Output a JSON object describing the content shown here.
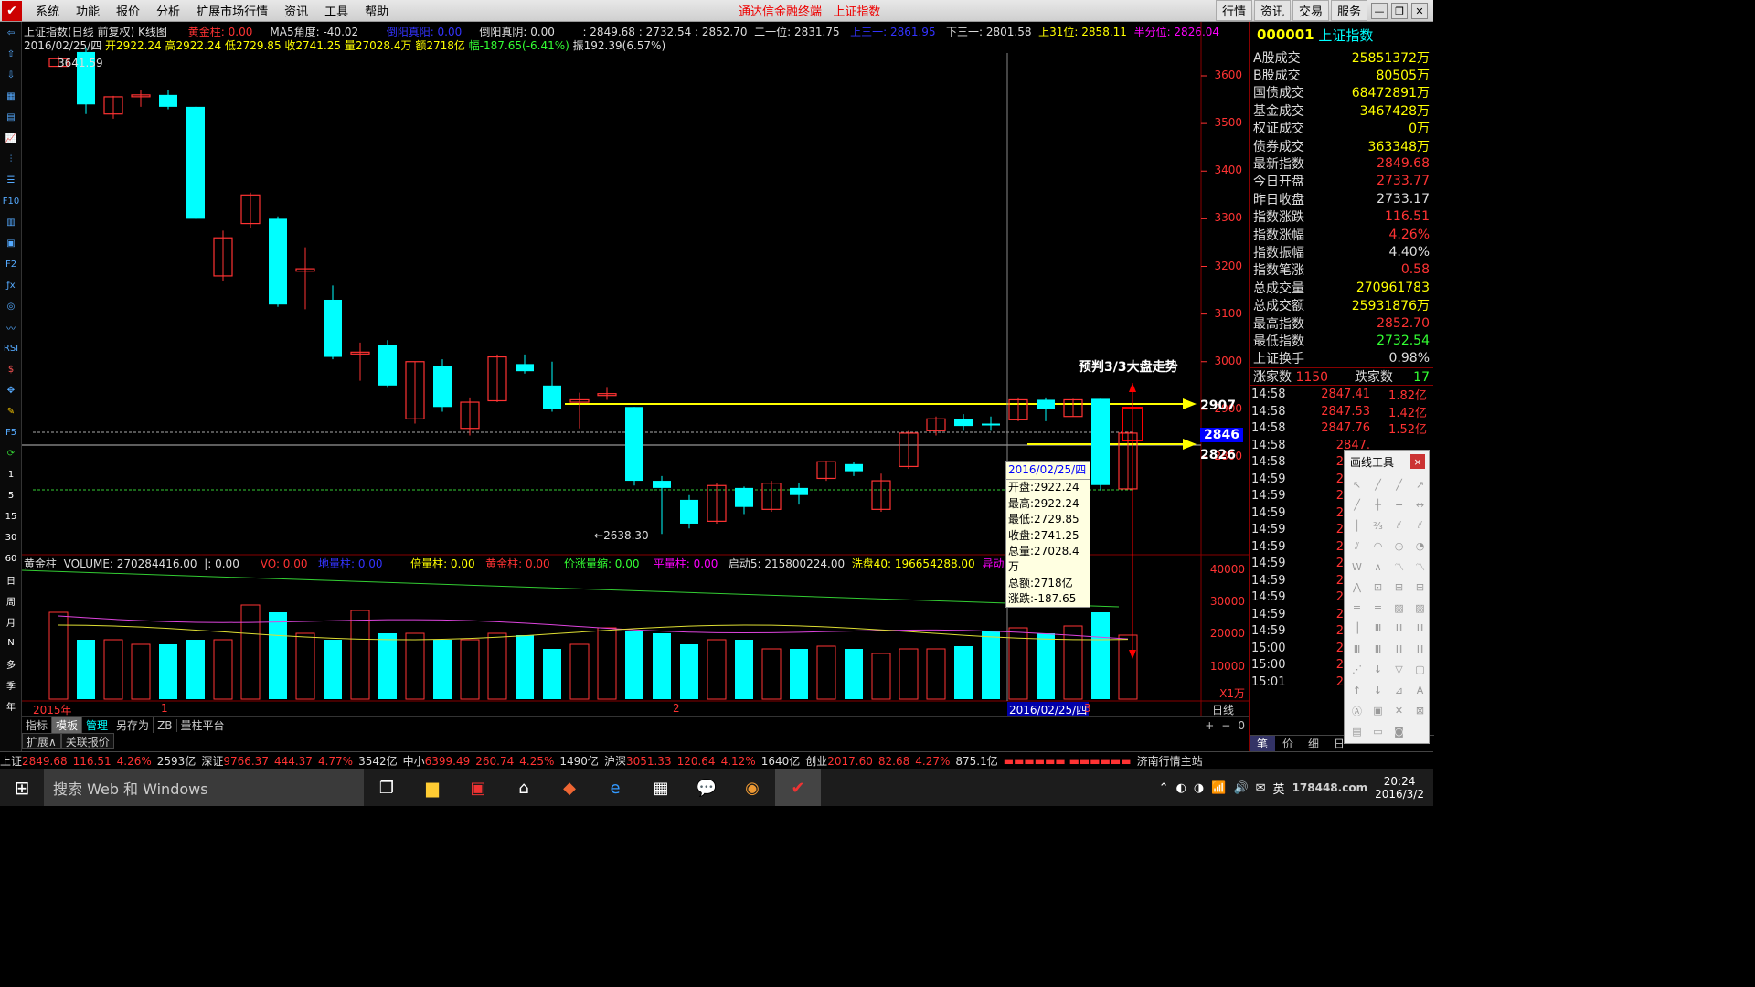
{
  "menu": {
    "items": [
      "系统",
      "功能",
      "报价",
      "分析",
      "扩展市场行情",
      "资讯",
      "工具",
      "帮助"
    ],
    "center_title": "通达信金融终端",
    "center_sub": "上证指数",
    "right_tabs": [
      "行情",
      "资讯",
      "交易",
      "服务"
    ]
  },
  "info": {
    "title": "上证指数(日线 前复权) K线图",
    "gold_col": "黄金柱: 0.00",
    "ma5_angle": "MA5角度: -40.02",
    "true_yin": "倒阳真阴: 0.00",
    "pct_cut": "倒阳真阳: 0.00",
    "prices": ": 2849.68 : 2732.54 : 2852.70",
    "two_one": "二一位: 2831.75",
    "up_three": "上三一: 2861.95",
    "down_three": "下三一: 2801.58",
    "up_31": "上31位: 2858.11",
    "half": "半分位: 2826.04",
    "date": "2016/02/25/四",
    "open": "开2922.24",
    "high": "高2922.24",
    "low": "低2729.85",
    "close": "收2741.25",
    "vol": "量27028.4万",
    "amt": "额2718亿",
    "chg": "幅-187.65(-6.41%)",
    "amp": "振192.39(6.57%)"
  },
  "chart_labels": {
    "high_mark": "3641.59",
    "low_mark": "2638.30",
    "predict": "预判3/3大盘走势",
    "level_2907": "2907",
    "level_2846": "2846",
    "level_2826": "2826"
  },
  "yaxis": [
    "3600",
    "3500",
    "3400",
    "3300",
    "3200",
    "3100",
    "3000",
    "2900",
    "2800"
  ],
  "vol_axis": [
    "40000",
    "30000",
    "20000",
    "10000",
    "X1万"
  ],
  "vol_info": {
    "name": "黄金柱",
    "volume": "VOLUME: 270284416.00",
    "i": "|: 0.00",
    "vo": "VO: 0.00",
    "dlz": "地量柱: 0.00",
    "blz": "倍量柱: 0.00",
    "hjz": "黄金柱: 0.00",
    "jzls": "价涨量缩: 0.00",
    "plz": "平量柱: 0.00",
    "qd5": "启动5: 215800224.00",
    "xp40": "洗盘40: 196654288.00",
    "yd135": "异动135: 28316236"
  },
  "xaxis": {
    "year": "2015年",
    "m1": "1",
    "m2": "2",
    "sel": "2016/02/25/四",
    "m3": "3",
    "period": "日线"
  },
  "tooltip": {
    "date": "2016/02/25/四",
    "open": "开盘:2922.24",
    "high": "最高:2922.24",
    "low": "最低:2729.85",
    "close": "收盘:2741.25",
    "vol": "总量:27028.4万",
    "amt": "总额:2718亿",
    "chg": "涨跌:-187.65",
    "pct": "涨幅:-6.41%"
  },
  "right": {
    "code": "000001",
    "name": "上证指数",
    "rows": [
      {
        "label": "A股成交",
        "value": "25851372万",
        "color": "#ff0"
      },
      {
        "label": "B股成交",
        "value": "80505万",
        "color": "#ff0"
      },
      {
        "label": "国债成交",
        "value": "68472891万",
        "color": "#ff0"
      },
      {
        "label": "基金成交",
        "value": "3467428万",
        "color": "#ff0"
      },
      {
        "label": "权证成交",
        "value": "0万",
        "color": "#ff0"
      },
      {
        "label": "债券成交",
        "value": "363348万",
        "color": "#ff0"
      },
      {
        "label": "最新指数",
        "value": "2849.68",
        "color": "#f33"
      },
      {
        "label": "今日开盘",
        "value": "2733.77",
        "color": "#f33"
      },
      {
        "label": "昨日收盘",
        "value": "2733.17",
        "color": "#ddd"
      },
      {
        "label": "指数涨跌",
        "value": "116.51",
        "color": "#f33"
      },
      {
        "label": "指数涨幅",
        "value": "4.26%",
        "color": "#f33"
      },
      {
        "label": "指数振幅",
        "value": "4.40%",
        "color": "#ddd"
      },
      {
        "label": "指数笔涨",
        "value": "0.58",
        "color": "#f33"
      },
      {
        "label": "总成交量",
        "value": "270961783",
        "color": "#ff0"
      },
      {
        "label": "总成交额",
        "value": "25931876万",
        "color": "#ff0"
      },
      {
        "label": "最高指数",
        "value": "2852.70",
        "color": "#f33"
      },
      {
        "label": "最低指数",
        "value": "2732.54",
        "color": "#3f3"
      },
      {
        "label": "上证换手",
        "value": "0.98%",
        "color": "#ddd"
      }
    ],
    "updown": {
      "up_label": "涨家数",
      "up": "1150",
      "down_label": "跌家数",
      "down": "17"
    },
    "ticks": [
      {
        "t": "14:58",
        "p": "2847.41",
        "v": "1.82亿"
      },
      {
        "t": "14:58",
        "p": "2847.53",
        "v": "1.42亿"
      },
      {
        "t": "14:58",
        "p": "2847.76",
        "v": "1.52亿"
      },
      {
        "t": "14:58",
        "p": "2847.",
        "v": ""
      },
      {
        "t": "14:58",
        "p": "2848.",
        "v": ""
      },
      {
        "t": "14:59",
        "p": "2848.",
        "v": ""
      },
      {
        "t": "14:59",
        "p": "2848.",
        "v": ""
      },
      {
        "t": "14:59",
        "p": "2848.",
        "v": ""
      },
      {
        "t": "14:59",
        "p": "2849.",
        "v": ""
      },
      {
        "t": "14:59",
        "p": "2849.",
        "v": ""
      },
      {
        "t": "14:59",
        "p": "2849.",
        "v": ""
      },
      {
        "t": "14:59",
        "p": "2849.",
        "v": ""
      },
      {
        "t": "14:59",
        "p": "2848.",
        "v": ""
      },
      {
        "t": "14:59",
        "p": "2849.",
        "v": ""
      },
      {
        "t": "14:59",
        "p": "2849.",
        "v": ""
      },
      {
        "t": "15:00",
        "p": "2849.",
        "v": ""
      },
      {
        "t": "15:00",
        "p": "2849.",
        "v": ""
      },
      {
        "t": "15:01",
        "p": "2849.",
        "v": ""
      }
    ],
    "bottom_tabs": [
      "笔",
      "价",
      "细",
      "日"
    ]
  },
  "drawtool": {
    "title": "画线工具",
    "close": "×"
  },
  "bottom": {
    "tabs": [
      "指标",
      "模板",
      "管理",
      "另存为",
      "ZB",
      "量柱平台"
    ],
    "tabs2": [
      "扩展∧",
      "关联报价"
    ],
    "nav": [
      "+",
      "−",
      "0"
    ]
  },
  "status": {
    "sh": "上证",
    "sh_v": "2849.68",
    "sh_c": "116.51",
    "sh_p": "4.26%",
    "sh_a": "2593亿",
    "sz": "深证",
    "sz_v": "9766.37",
    "sz_c": "444.37",
    "sz_p": "4.77%",
    "sz_a": "3542亿",
    "zx": "中小",
    "zx_v": "6399.49",
    "zx_c": "260.74",
    "zx_p": "4.25%",
    "zx_a": "1490亿",
    "hs": "沪深",
    "hs_v": "3051.33",
    "hs_c": "120.64",
    "hs_p": "4.12%",
    "hs_a": "1640亿",
    "cy": "创业",
    "cy_v": "2017.60",
    "cy_c": "82.68",
    "cy_p": "4.27%",
    "cy_a": "875.1亿",
    "site": "济南行情主站"
  },
  "taskbar": {
    "search": "搜索 Web 和 Windows",
    "ime": "英",
    "time": "20:24",
    "date": "2016/3/2",
    "watermark": "178448.com"
  },
  "chart_data": {
    "type": "candlestick",
    "title": "上证指数(日线 前复权) K线图",
    "ylim": [
      2600,
      3650
    ],
    "levels": [
      2907,
      2846,
      2826
    ],
    "candles": [
      {
        "o": 3620,
        "c": 3636,
        "h": 3641.59,
        "l": 3620,
        "up": true
      },
      {
        "o": 3650,
        "c": 3540,
        "h": 3660,
        "l": 3520,
        "up": false
      },
      {
        "o": 3520,
        "c": 3556,
        "h": 3558,
        "l": 3510,
        "up": true
      },
      {
        "o": 3557,
        "c": 3560,
        "h": 3570,
        "l": 3535,
        "up": true
      },
      {
        "o": 3560,
        "c": 3535,
        "h": 3570,
        "l": 3530,
        "up": false
      },
      {
        "o": 3535,
        "c": 3300,
        "h": 3535,
        "l": 3300,
        "up": false
      },
      {
        "o": 3180,
        "c": 3260,
        "h": 3275,
        "l": 3170,
        "up": true
      },
      {
        "o": 3290,
        "c": 3350,
        "h": 3355,
        "l": 3280,
        "up": true
      },
      {
        "o": 3300,
        "c": 3120,
        "h": 3305,
        "l": 3115,
        "up": false
      },
      {
        "o": 3190,
        "c": 3195,
        "h": 3240,
        "l": 3110,
        "up": true
      },
      {
        "o": 3130,
        "c": 3010,
        "h": 3160,
        "l": 3005,
        "up": false
      },
      {
        "o": 3018,
        "c": 3020,
        "h": 3040,
        "l": 2960,
        "up": true
      },
      {
        "o": 3035,
        "c": 2950,
        "h": 3045,
        "l": 2945,
        "up": false
      },
      {
        "o": 2880,
        "c": 3000,
        "h": 3000,
        "l": 2870,
        "up": true
      },
      {
        "o": 2990,
        "c": 2905,
        "h": 3005,
        "l": 2895,
        "up": false
      },
      {
        "o": 2860,
        "c": 2915,
        "h": 2925,
        "l": 2845,
        "up": true
      },
      {
        "o": 2918,
        "c": 3010,
        "h": 3015,
        "l": 2915,
        "up": true
      },
      {
        "o": 2995,
        "c": 2980,
        "h": 3015,
        "l": 2975,
        "up": false
      },
      {
        "o": 2950,
        "c": 2900,
        "h": 3000,
        "l": 2895,
        "up": false
      },
      {
        "o": 2915,
        "c": 2920,
        "h": 2935,
        "l": 2860,
        "up": true
      },
      {
        "o": 2930,
        "c": 2933,
        "h": 2945,
        "l": 2920,
        "up": true
      },
      {
        "o": 2905,
        "c": 2750,
        "h": 2905,
        "l": 2740,
        "up": false
      },
      {
        "o": 2750,
        "c": 2735,
        "h": 2760,
        "l": 2638.3,
        "up": false
      },
      {
        "o": 2710,
        "c": 2660,
        "h": 2720,
        "l": 2650,
        "up": false
      },
      {
        "o": 2665,
        "c": 2740,
        "h": 2745,
        "l": 2660,
        "up": true
      },
      {
        "o": 2735,
        "c": 2695,
        "h": 2738,
        "l": 2680,
        "up": false
      },
      {
        "o": 2690,
        "c": 2745,
        "h": 2750,
        "l": 2685,
        "up": true
      },
      {
        "o": 2735,
        "c": 2720,
        "h": 2745,
        "l": 2700,
        "up": false
      },
      {
        "o": 2755,
        "c": 2790,
        "h": 2792,
        "l": 2750,
        "up": true
      },
      {
        "o": 2785,
        "c": 2770,
        "h": 2790,
        "l": 2760,
        "up": false
      },
      {
        "o": 2690,
        "c": 2750,
        "h": 2765,
        "l": 2685,
        "up": true
      },
      {
        "o": 2780,
        "c": 2850,
        "h": 2855,
        "l": 2775,
        "up": true
      },
      {
        "o": 2855,
        "c": 2880,
        "h": 2885,
        "l": 2845,
        "up": true
      },
      {
        "o": 2880,
        "c": 2865,
        "h": 2890,
        "l": 2855,
        "up": false
      },
      {
        "o": 2870,
        "c": 2870,
        "h": 2885,
        "l": 2855,
        "up": false
      },
      {
        "o": 2878,
        "c": 2920,
        "h": 2925,
        "l": 2875,
        "up": true
      },
      {
        "o": 2920,
        "c": 2900,
        "h": 2925,
        "l": 2875,
        "up": false
      },
      {
        "o": 2885,
        "c": 2920,
        "h": 2922,
        "l": 2885,
        "up": true
      },
      {
        "o": 2922,
        "c": 2741,
        "h": 2922.24,
        "l": 2729.85,
        "up": false
      },
      {
        "o": 2733,
        "c": 2850,
        "h": 2853,
        "l": 2733,
        "up": true
      }
    ]
  }
}
